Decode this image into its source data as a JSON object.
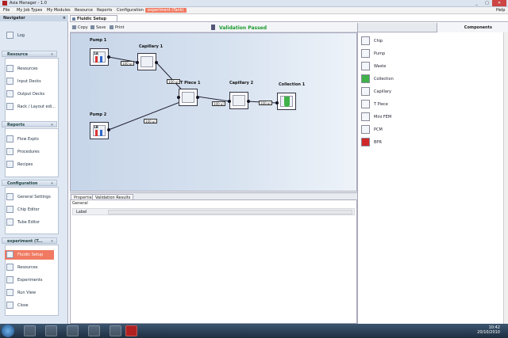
{
  "window": {
    "title": "Asia Manager - 1.0"
  },
  "menu": [
    "File",
    "My Job Types",
    "My Modules",
    "Resource",
    "Reports",
    "Configuration",
    "experiment (Tank)",
    "Help"
  ],
  "navigator": {
    "title": "Navigator",
    "top_item": "Log",
    "sections": [
      {
        "title": "Resource",
        "items": [
          "Resources",
          "Input Decks",
          "Output Decks",
          "Rack / Layout edi..."
        ]
      },
      {
        "title": "Reports",
        "items": [
          "Flow Expts",
          "Procedures",
          "Recipes"
        ]
      },
      {
        "title": "Configuration",
        "items": [
          "General Settings",
          "Chip Editor",
          "Tube Editor"
        ]
      },
      {
        "title": "experiment (T...",
        "items": [
          "Fluidic Setup",
          "Resources",
          "Experiments",
          "Run View",
          "Close"
        ]
      }
    ]
  },
  "doc_tab": "Fluidic Setup",
  "toolbar": {
    "copy": "Copy",
    "save": "Save",
    "print": "Print",
    "validation": "Validation Passed"
  },
  "components_panel": {
    "tab": "Components",
    "items": [
      "Chip",
      "Pump",
      "Waste",
      "Collection",
      "Capillary",
      "T Piece",
      "Mini FEM",
      "PCM",
      "BPR"
    ]
  },
  "diagram": {
    "nodes": [
      {
        "title": "Pump 1",
        "label": "1A"
      },
      {
        "title": "Capillary 1",
        "label": ""
      },
      {
        "title": "T Piece 1",
        "label": ""
      },
      {
        "title": "Capillary 2",
        "label": ""
      },
      {
        "title": "Collection 1",
        "label": ""
      },
      {
        "title": "Pump 2",
        "label": "1B"
      }
    ],
    "flows": [
      "100 µl",
      "100 µl",
      "100 µl",
      "100 µl",
      "100 µl"
    ]
  },
  "properties": {
    "tabs": [
      "Properties",
      "Validation Results"
    ],
    "group": "General",
    "fields": [
      {
        "label": "Label",
        "value": ""
      }
    ]
  },
  "taskbar": {
    "time": "10:42",
    "date": "20/10/2010"
  }
}
